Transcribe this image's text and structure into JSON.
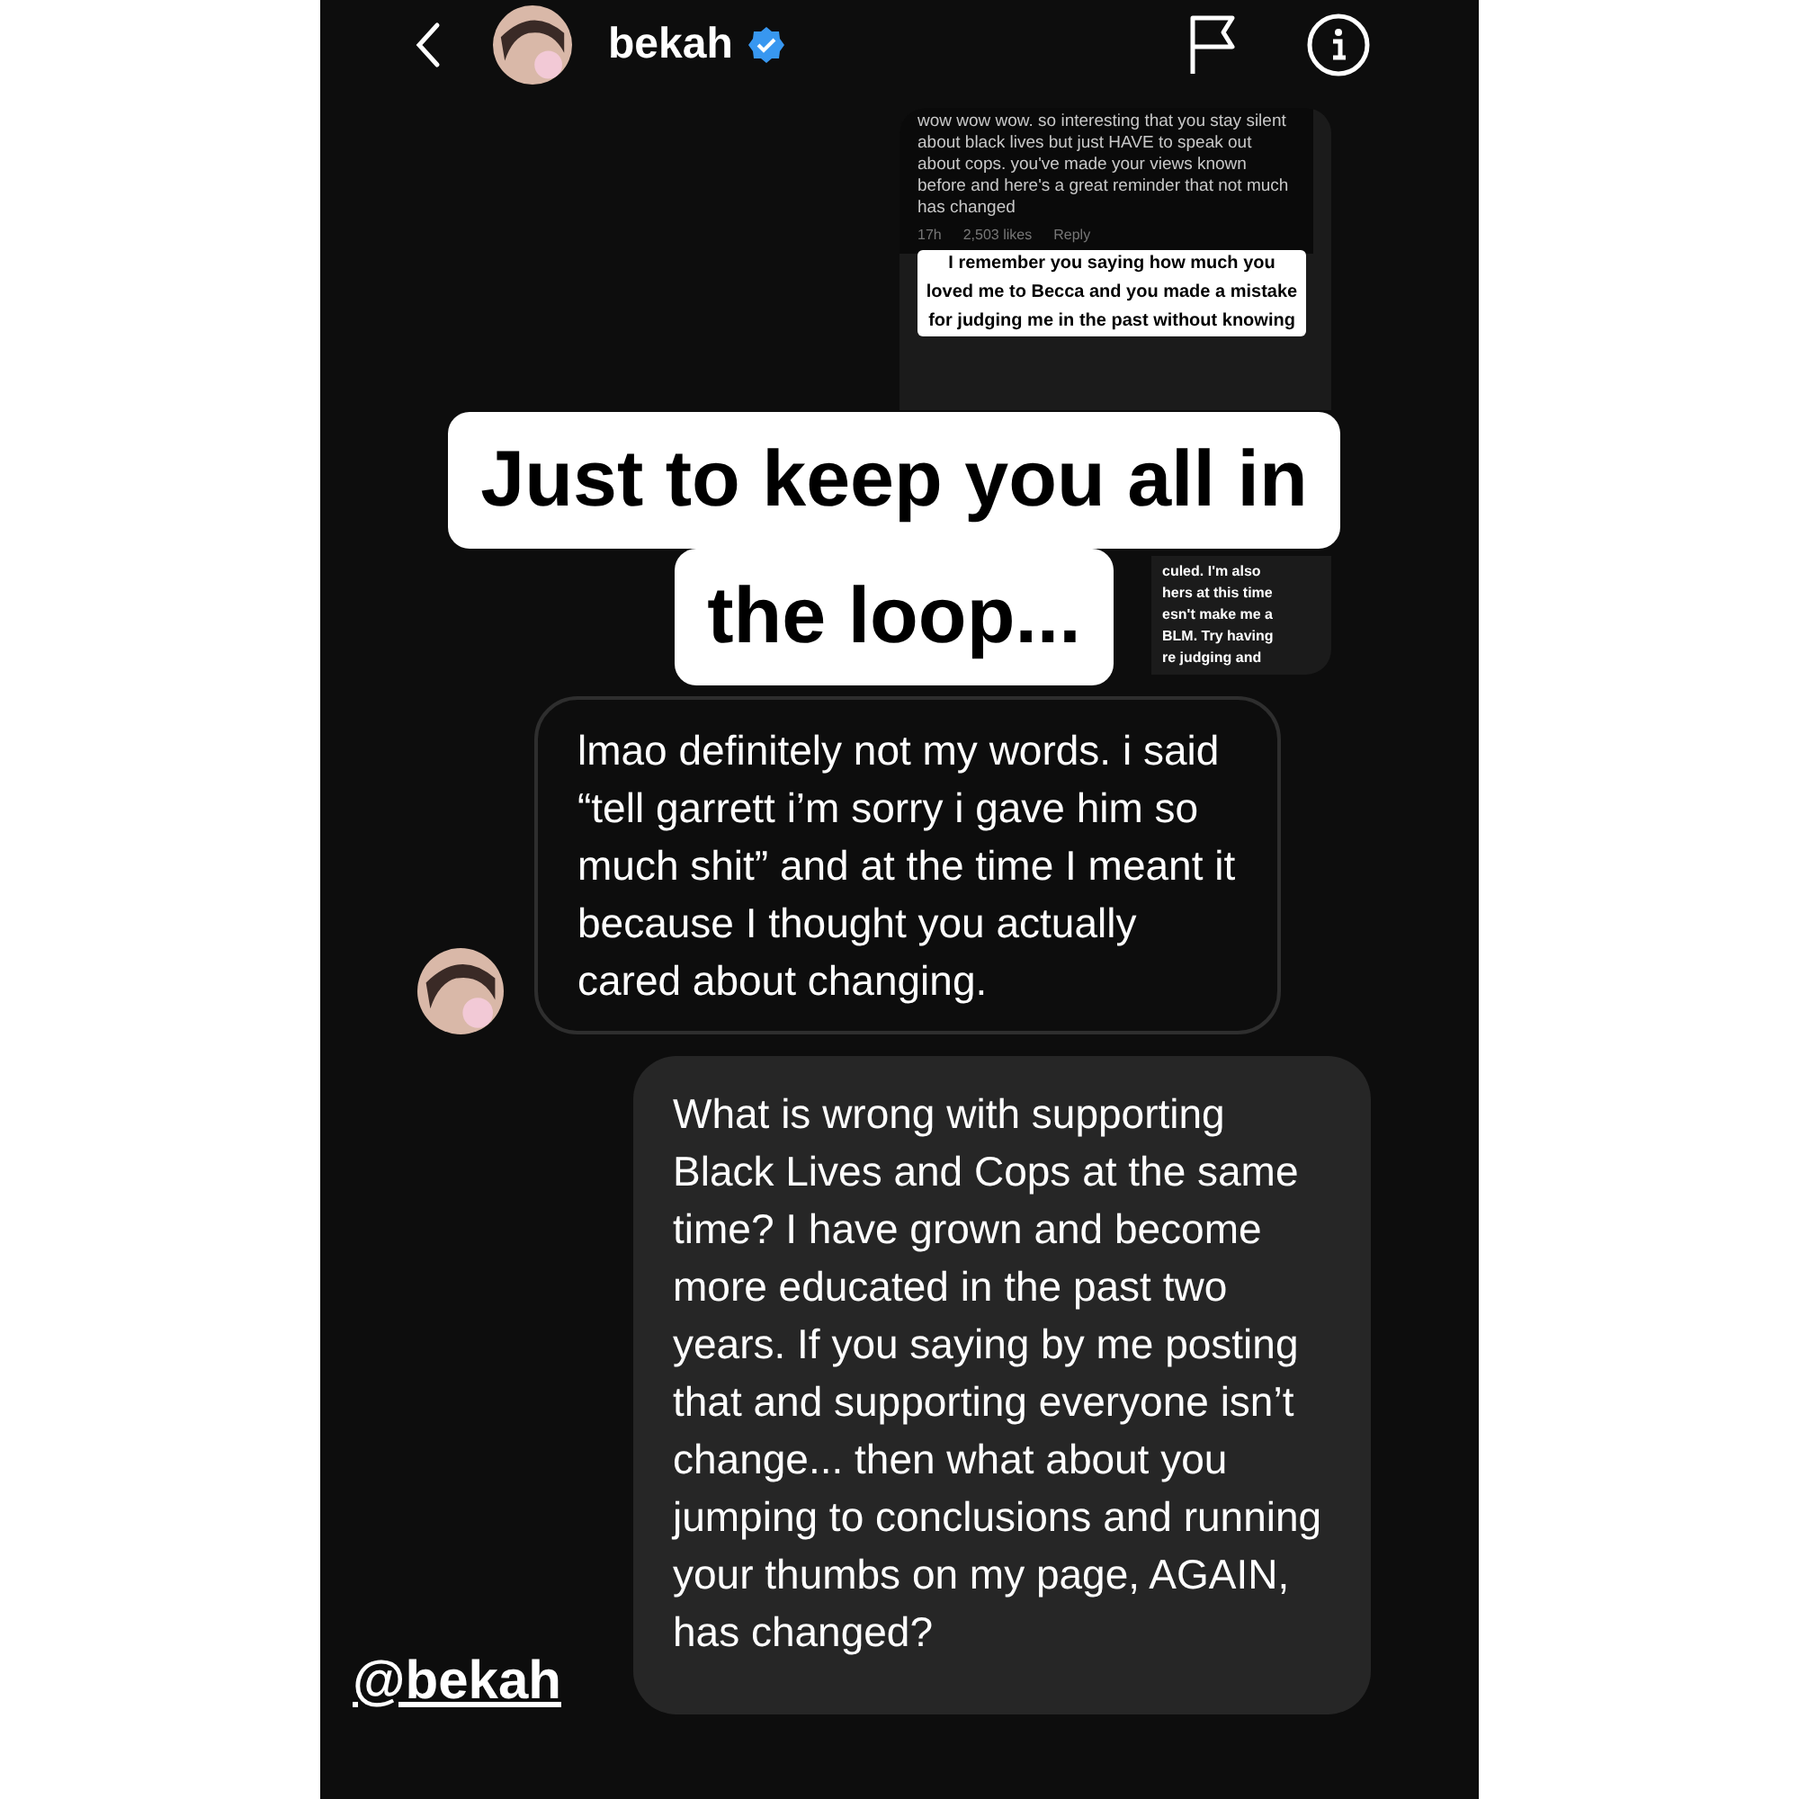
{
  "header": {
    "name": "bekah",
    "verified": true
  },
  "shared_post": {
    "comment": "wow wow wow. so interesting that you stay silent about black lives but just HAVE to speak out about cops. you've made your views known before and here's a great reminder that not much has changed",
    "comment_time": "17h",
    "comment_likes": "2,503 likes",
    "comment_reply": "Reply",
    "sticker_text": "I remember you saying how much you loved me to Becca and you made a mistake for judging me in the past without knowing",
    "hidden_lines": [
      "culed. I'm also",
      "hers at this time",
      "esn't make me a",
      "BLM. Try having",
      "re judging and"
    ]
  },
  "caption_lines": [
    "Just to keep you all in",
    "the loop..."
  ],
  "messages": [
    {
      "kind": "received",
      "text": "lmao definitely not my words. i said “tell garrett i’m sorry i gave him so much shit” and at the time I meant it because I thought you actually cared about changing."
    },
    {
      "kind": "sent",
      "text": "What is wrong with supporting Black Lives and Cops at the same time? I have grown and become more educated in the past two years. If you saying by me posting that and supporting everyone isn’t change... then what about you jumping to conclusions and running your thumbs on my page, AGAIN, has changed?"
    }
  ],
  "mention": "@bekah"
}
